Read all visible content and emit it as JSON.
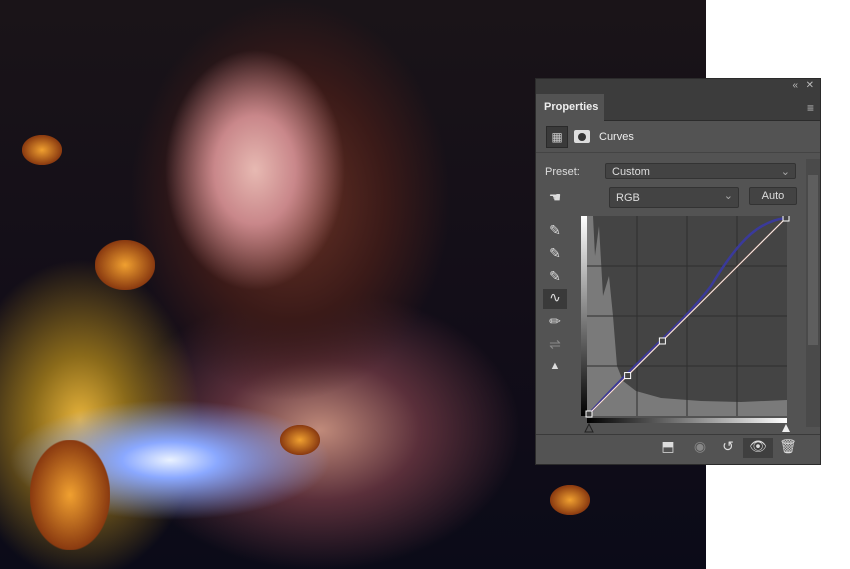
{
  "panel": {
    "tab_label": "Properties",
    "title": "Curves",
    "preset_label": "Preset:",
    "preset_value": "Custom",
    "channel_value": "RGB",
    "auto_label": "Auto"
  },
  "curve": {
    "rgb_points": [
      [
        0,
        0
      ],
      [
        50,
        50
      ],
      [
        95,
        95
      ],
      [
        255,
        255
      ]
    ],
    "input_range": [
      0,
      255
    ]
  },
  "icons": {
    "collapse": "«",
    "close": "✕",
    "menu": "≡",
    "chevron": "⌄"
  }
}
